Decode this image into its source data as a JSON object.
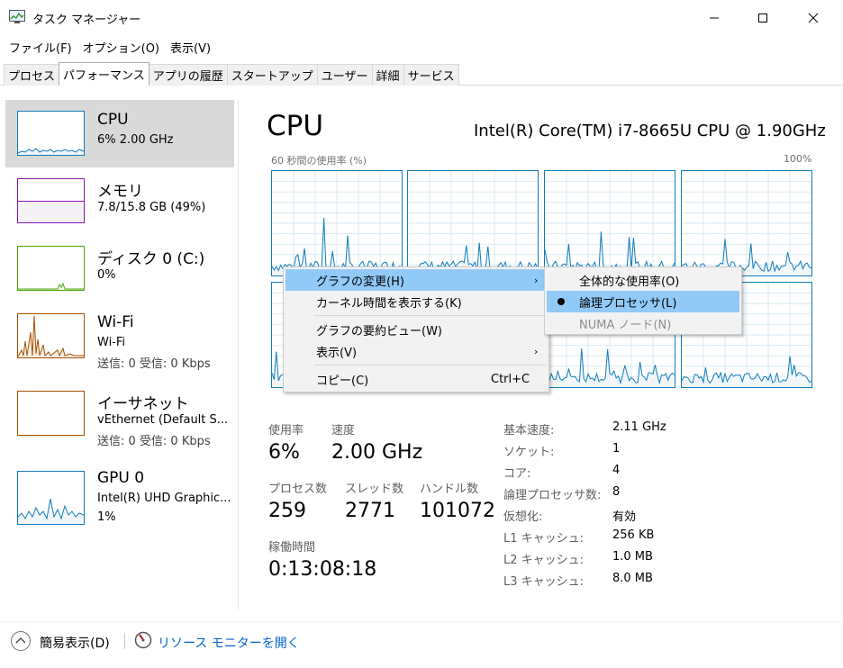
{
  "window": {
    "title": "タスク マネージャー"
  },
  "menubar": {
    "items": [
      "ファイル(F)",
      "オプション(O)",
      "表示(V)"
    ]
  },
  "tabs": [
    "プロセス",
    "パフォーマンス",
    "アプリの履歴",
    "スタートアップ",
    "ユーザー",
    "詳細",
    "サービス"
  ],
  "sidebar": {
    "items": [
      {
        "name": "CPU",
        "sub": "6% 2.00 GHz",
        "sub2": ""
      },
      {
        "name": "メモリ",
        "sub": "7.8/15.8 GB (49%)",
        "sub2": ""
      },
      {
        "name": "ディスク 0 (C:)",
        "sub": "0%",
        "sub2": ""
      },
      {
        "name": "Wi-Fi",
        "sub": "Wi-Fi",
        "sub2": "送信: 0 受信: 0 Kbps"
      },
      {
        "name": "イーサネット",
        "sub": "vEthernet (Default S...",
        "sub2": "送信: 0 受信: 0 Kbps"
      },
      {
        "name": "GPU 0",
        "sub": "Intel(R) UHD Graphic...",
        "sub2": "1%"
      }
    ],
    "colors": {
      "cpu": "#117dbb",
      "memory": "#8b12ae",
      "disk": "#4da60c",
      "wifi": "#a74f01",
      "ethernet": "#a74f01",
      "gpu": "#117dbb"
    }
  },
  "main": {
    "title": "CPU",
    "model": "Intel(R) Core(TM) i7-8665U CPU @ 1.90GHz",
    "axis_left": "60 秒間の使用率 (%)",
    "axis_right": "100%",
    "graph_color": "#117dbb"
  },
  "stats": {
    "usage_label": "使用率",
    "usage_value": "6%",
    "speed_label": "速度",
    "speed_value": "2.00 GHz",
    "processes_label": "プロセス数",
    "processes_value": "259",
    "threads_label": "スレッド数",
    "threads_value": "2771",
    "handles_label": "ハンドル数",
    "handles_value": "101072",
    "uptime_label": "稼働時間",
    "uptime_value": "0:13:08:18"
  },
  "info": [
    {
      "label": "基本速度:",
      "value": "2.11 GHz"
    },
    {
      "label": "ソケット:",
      "value": "1"
    },
    {
      "label": "コア:",
      "value": "4"
    },
    {
      "label": "論理プロセッサ数:",
      "value": "8"
    },
    {
      "label": "仮想化:",
      "value": "有効"
    },
    {
      "label": "L1 キャッシュ:",
      "value": "256 KB"
    },
    {
      "label": "L2 キャッシュ:",
      "value": "1.0 MB"
    },
    {
      "label": "L3 キャッシュ:",
      "value": "8.0 MB"
    }
  ],
  "context_menu": {
    "change_graph": "グラフの変更(H)",
    "show_kernel": "カーネル時間を表示する(K)",
    "summary_view": "グラフの要約ビュー(W)",
    "view": "表示(V)",
    "copy": "コピー(C)",
    "copy_shortcut": "Ctrl+C"
  },
  "submenu": {
    "overall": "全体的な使用率(O)",
    "logical": "論理プロセッサ(L)",
    "numa": "NUMA ノード(N)"
  },
  "footer": {
    "fewer_details": "簡易表示(D)",
    "resource_monitor": "リソース モニターを開く"
  }
}
